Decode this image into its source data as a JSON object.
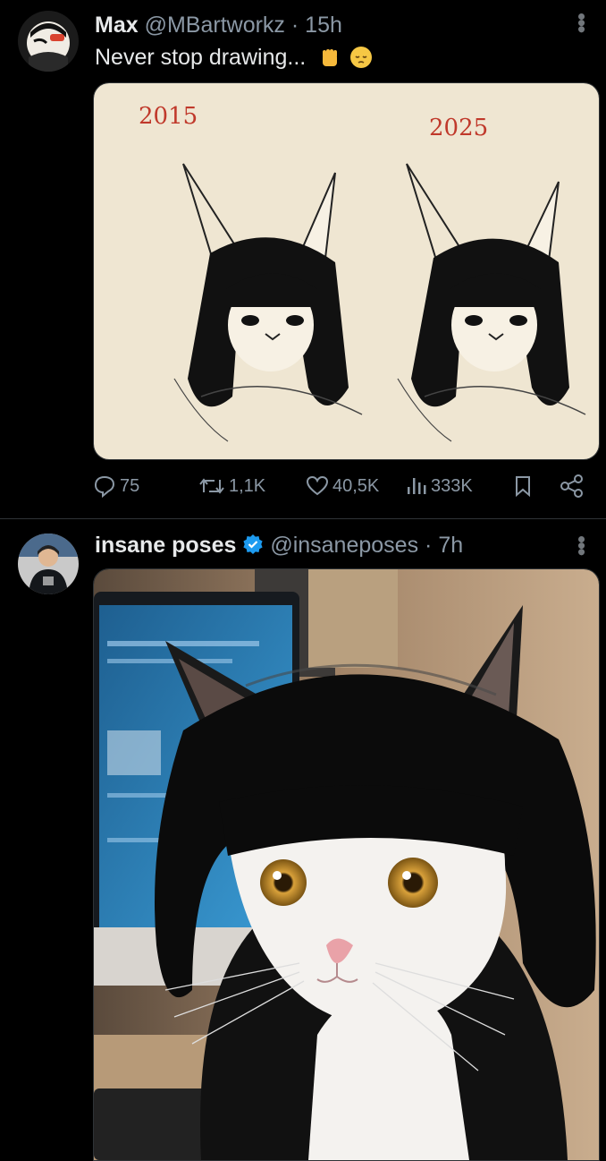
{
  "tweets": [
    {
      "display_name": "Max",
      "handle": "@MBartworkz",
      "separator": "·",
      "time": "15h",
      "text": "Never stop drawing...",
      "emoji_icons": [
        "raised-fist-icon",
        "pensive-face-icon"
      ],
      "media": {
        "label_left": "2015",
        "label_right": "2025",
        "label_color": "#c0392b",
        "paper_color": "#efe6d2"
      },
      "actions": {
        "replies": "75",
        "retweets": "1,1K",
        "likes": "40,5K",
        "views": "333K"
      }
    },
    {
      "display_name": "insane poses",
      "verified": true,
      "handle": "@insaneposes",
      "separator": "·",
      "time": "7h"
    }
  ],
  "colors": {
    "background": "#000000",
    "text_primary": "#e7e9ea",
    "text_secondary": "#8b98a5",
    "verified_blue": "#1d9bf0",
    "divider": "#2f3336"
  }
}
